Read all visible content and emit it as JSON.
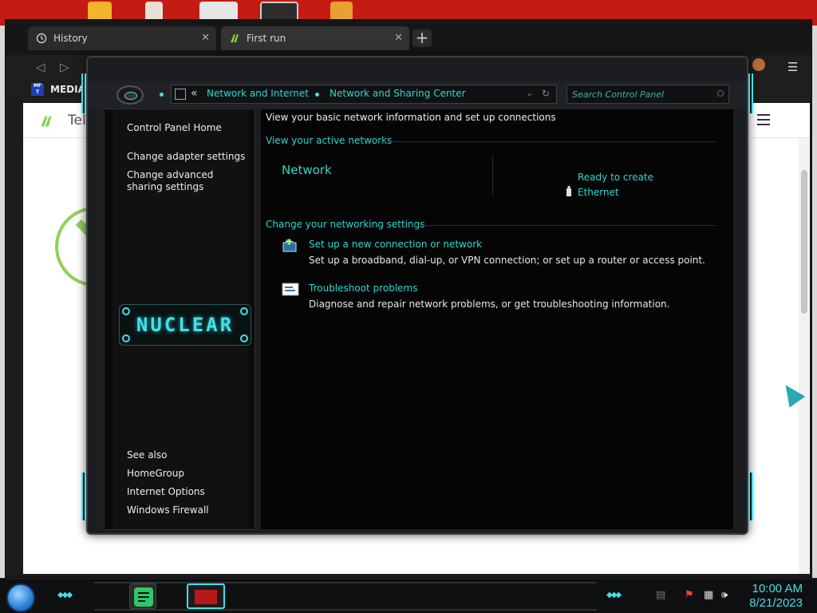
{
  "browser": {
    "tabs": [
      {
        "label": "History",
        "icon": "history-icon"
      },
      {
        "label": "First run",
        "icon": "app-logo-icon"
      }
    ],
    "bookmark": "MEDIAF",
    "bookmark_icon_text": "MF T",
    "page_header": "Tele"
  },
  "control_panel": {
    "back_glyph": "«",
    "breadcrumbs": [
      "Network and Internet",
      "Network and Sharing Center"
    ],
    "search_placeholder": "Search Control Panel",
    "left_nav": {
      "home": "Control Panel Home",
      "tasks": [
        "Change adapter settings",
        "Change advanced sharing settings"
      ],
      "logo": "NUCLEAR",
      "see_also": "See also",
      "see_also_links": [
        "HomeGroup",
        "Internet Options",
        "Windows Firewall"
      ]
    },
    "main": {
      "heading": "View your basic network information and set up connections",
      "active_networks_title": "View your active networks",
      "network": {
        "name": "Network",
        "access_type": "Ready to create",
        "connection": "Ethernet"
      },
      "change_settings_title": "Change your networking settings",
      "tasks": [
        {
          "title": "Set up a new connection or network",
          "description": "Set up a broadband, dial-up, or VPN connection; or set up a router or access point.",
          "icon": "network-setup-icon"
        },
        {
          "title": "Troubleshoot problems",
          "description": "Diagnose and repair network problems, or get troubleshooting information.",
          "icon": "troubleshoot-icon"
        }
      ]
    }
  },
  "taskbar": {
    "time": "10:00 AM",
    "date": "8/21/2023"
  },
  "colors": {
    "accent": "#2fd6cc",
    "desktop": "#c41b12",
    "panel_bg": "#050505"
  }
}
